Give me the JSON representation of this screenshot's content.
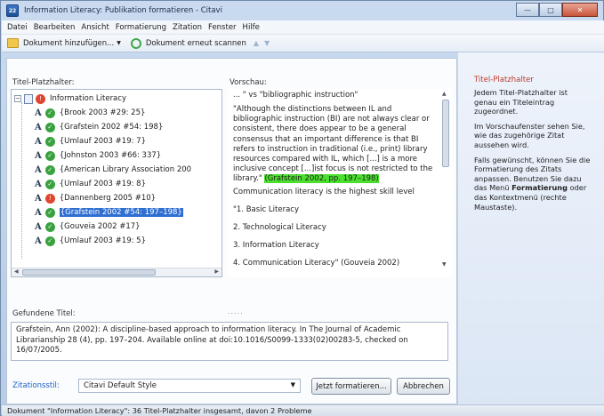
{
  "window": {
    "title": "Information Literacy: Publikation formatieren - Citavi",
    "icon_text": "22"
  },
  "menubar": [
    "Datei",
    "Bearbeiten",
    "Ansicht",
    "Formatierung",
    "Zitation",
    "Fenster",
    "Hilfe"
  ],
  "toolbar": {
    "add_document": "Dokument hinzufügen...",
    "rescan_document": "Dokument erneut scannen"
  },
  "placeholders": {
    "label": "Titel-Platzhalter:",
    "root": "Information Literacy",
    "items": [
      {
        "text": "{Brook 2003 #29: 25}",
        "status": "ok"
      },
      {
        "text": "{Grafstein 2002 #54: 198}",
        "status": "ok"
      },
      {
        "text": "{Umlauf 2003 #19: 7}",
        "status": "ok"
      },
      {
        "text": "{Johnston 2003 #66: 337}",
        "status": "ok"
      },
      {
        "text": "{American Library Association 200",
        "status": "ok"
      },
      {
        "text": "{Umlauf 2003 #19: 8}",
        "status": "ok"
      },
      {
        "text": "{Dannenberg 2005 #10}",
        "status": "error"
      },
      {
        "text": "{Grafstein 2002 #54: 197–198}",
        "status": "ok",
        "selected": true
      },
      {
        "text": "{Gouveia 2002 #17}",
        "status": "ok"
      },
      {
        "text": "{Umlauf 2003 #19: 5}",
        "status": "ok"
      }
    ]
  },
  "preview": {
    "label": "Vorschau:",
    "paragraphs": [
      "... \" vs \"bibliographic instruction\"",
      "\"Although the distinctions between IL and bibliographic instruction (BI) are not always clear or consistent, there does appear to be a general consensus that an important difference is that BI refers to instruction in traditional (i.e., print) library resources compared with IL, which [...] is a more inclusive concept [...]ist focus is not restricted to the library.\"",
      "Communication literacy is the highest skill level",
      "\"1. Basic Literacy",
      "2. Technological Literacy",
      "3. Information Literacy",
      "4. Communication Literacy\" (Gouveia 2002)"
    ],
    "highlighted_citation": "(Grafstein 2002, pp. 197–198)"
  },
  "found_title": {
    "label": "Gefundene Titel:",
    "text": "Grafstein, Ann (2002): A discipline-based approach to information literacy. In The Journal of Academic Librarianship 28 (4), pp. 197–204. Available online at doi:10.1016/S0099-1333(02)00283-5, checked on 16/07/2005."
  },
  "citation_style": {
    "label": "Zitationsstil:",
    "value": "Citavi Default Style"
  },
  "buttons": {
    "format": "Jetzt formatieren...",
    "cancel": "Abbrechen"
  },
  "help": {
    "title": "Titel-Platzhalter",
    "p1": "Jedem Titel-Platzhalter ist genau ein Titeleintrag zugeordnet.",
    "p2": "Im Vorschaufenster sehen Sie, wie das zugehörige Zitat aussehen wird.",
    "p3_pre": "Falls gewünscht, können Sie die Formatierung des Zitats anpassen. Benutzen Sie dazu das Menü ",
    "p3_bold": "Formatierung",
    "p3_post": " oder das Kontextmenü (rechte Maustaste)."
  },
  "status": "Dokument \"Information Literacy\": 36 Titel-Platzhalter insgesamt, davon 2 Probleme",
  "colors": {
    "accent": "#2f6fd1",
    "highlight": "#4be02d",
    "ok": "#39a23f",
    "error": "#e0452f",
    "help_title": "#c0392b"
  }
}
